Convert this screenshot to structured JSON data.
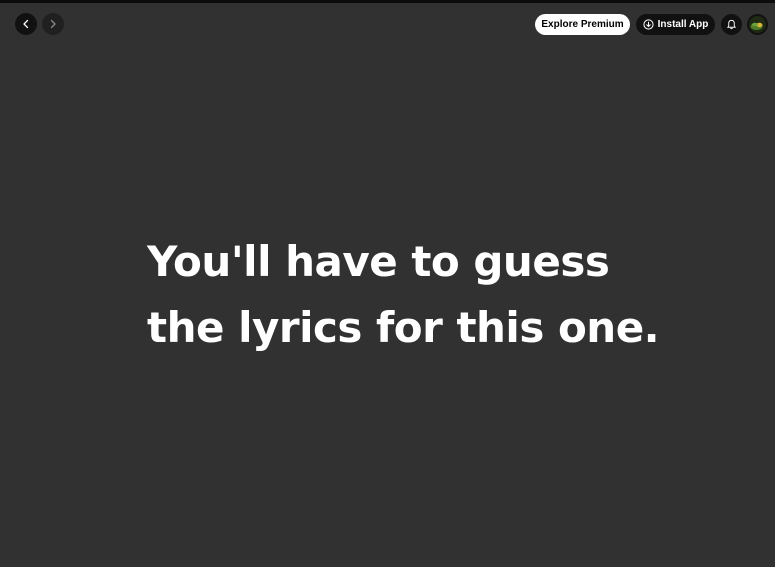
{
  "topbar": {
    "back_icon": "chevron-left-icon",
    "forward_icon": "chevron-right-icon",
    "premium_label": "Explore Premium",
    "install_label": "Install App",
    "install_icon": "download-circle-icon",
    "notifications_icon": "bell-icon",
    "avatar_icon": "user-avatar"
  },
  "lyrics": {
    "line1": "You'll have to guess",
    "line2": "the lyrics for this one."
  },
  "colors": {
    "background": "#313131",
    "button_dark": "#111111",
    "premium_bg": "#ffffff",
    "text": "#ffffff"
  }
}
